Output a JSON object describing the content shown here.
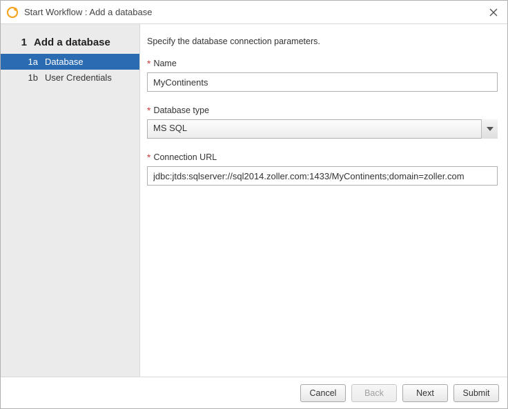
{
  "window": {
    "title": "Start Workflow : Add a database"
  },
  "sidebar": {
    "step_num": "1",
    "step_title": "Add a database",
    "items": [
      {
        "num": "1a",
        "label": "Database",
        "active": true
      },
      {
        "num": "1b",
        "label": "User Credentials",
        "active": false
      }
    ]
  },
  "content": {
    "intro": "Specify the database connection parameters.",
    "fields": {
      "name": {
        "label": "Name",
        "value": "MyContinents"
      },
      "dbtype": {
        "label": "Database type",
        "value": "MS SQL"
      },
      "url": {
        "label": "Connection URL",
        "value": "jdbc:jtds:sqlserver://sql2014.zoller.com:1433/MyContinents;domain=zoller.com"
      }
    }
  },
  "footer": {
    "cancel": "Cancel",
    "back": "Back",
    "next": "Next",
    "submit": "Submit"
  }
}
